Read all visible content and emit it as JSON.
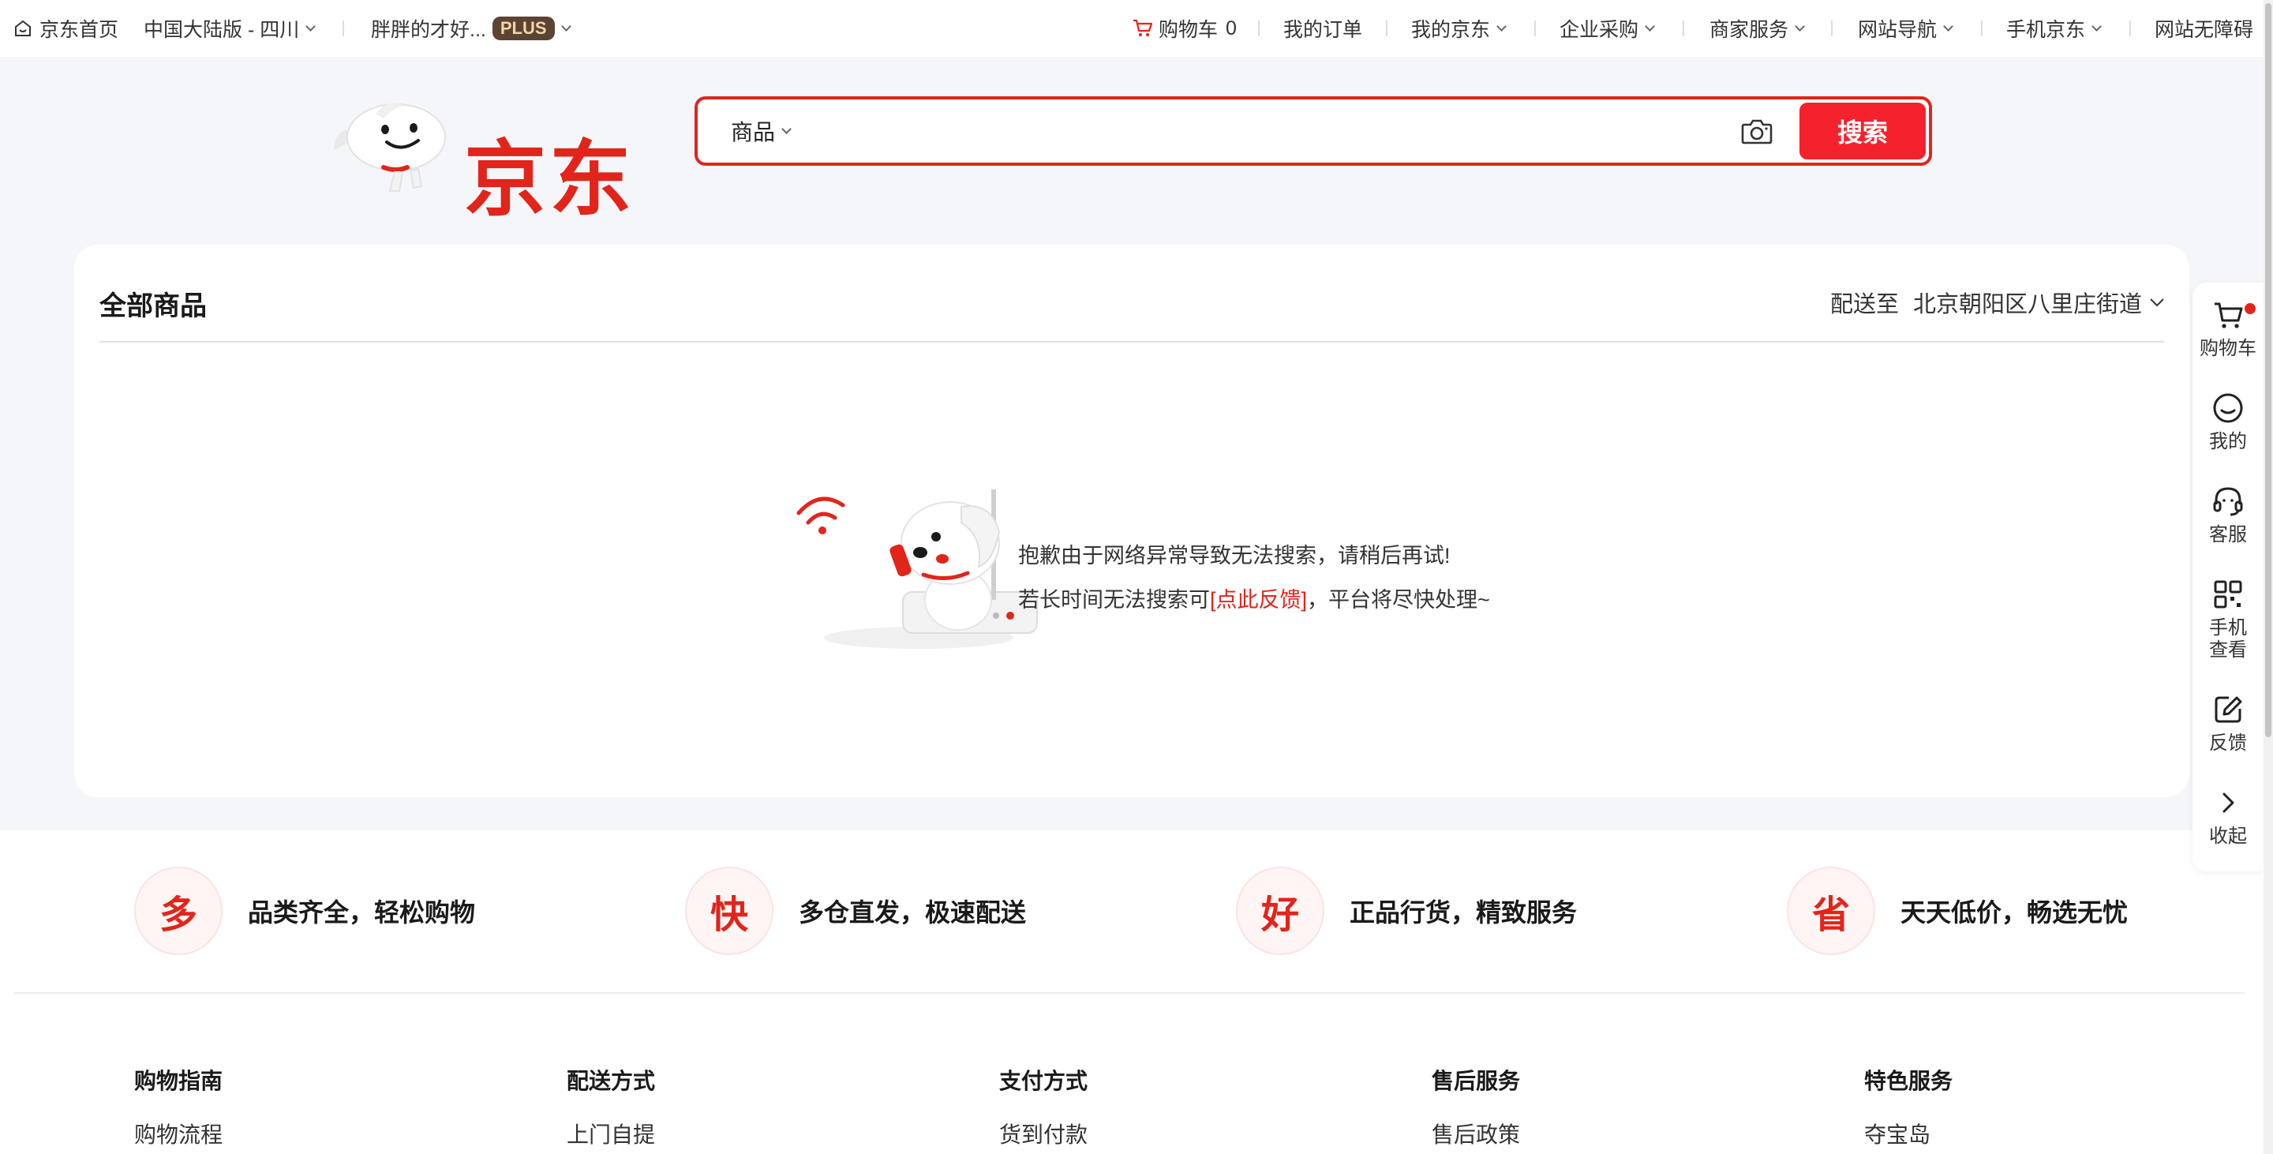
{
  "topbar": {
    "home": "京东首页",
    "region": "中国大陆版 - 四川",
    "user": "胖胖的才好...",
    "plus_badge": "PLUS",
    "cart_label": "购物车",
    "cart_count": "0",
    "orders": "我的订单",
    "my_jd": "我的京东",
    "enterprise": "企业采购",
    "merchant": "商家服务",
    "site_nav": "网站导航",
    "mobile_jd": "手机京东",
    "accessibility": "网站无障碍"
  },
  "logo": {
    "text": "京东"
  },
  "search": {
    "category": "商品",
    "value": "",
    "placeholder": "",
    "button": "搜索"
  },
  "main": {
    "title": "全部商品",
    "deliver_label": "配送至",
    "deliver_addr": "北京朝阳区八里庄街道",
    "error_line1": "抱歉由于网络异常导致无法搜索，请稍后再试!",
    "error_line2_pre": "若长时间无法搜索可",
    "error_link": "[点此反馈]",
    "error_line2_post": "，平台将尽快处理~"
  },
  "features": [
    {
      "char": "多",
      "text": "品类齐全，轻松购物"
    },
    {
      "char": "快",
      "text": "多仓直发，极速配送"
    },
    {
      "char": "好",
      "text": "正品行货，精致服务"
    },
    {
      "char": "省",
      "text": "天天低价，畅选无忧"
    }
  ],
  "footer": [
    {
      "title": "购物指南",
      "item": "购物流程"
    },
    {
      "title": "配送方式",
      "item": "上门自提"
    },
    {
      "title": "支付方式",
      "item": "货到付款"
    },
    {
      "title": "售后服务",
      "item": "售后政策"
    },
    {
      "title": "特色服务",
      "item": "夺宝岛"
    }
  ],
  "sidebar": [
    {
      "label": "购物车",
      "icon": "cart-icon"
    },
    {
      "label": "我的",
      "icon": "smile-icon"
    },
    {
      "label": "客服",
      "icon": "headset-icon"
    },
    {
      "label": "手机查看",
      "icon": "qrcode-icon"
    },
    {
      "label": "反馈",
      "icon": "edit-icon"
    },
    {
      "label": "收起",
      "icon": "chevron-right-icon"
    }
  ],
  "colors": {
    "brand": "#e1251b",
    "search_button": "#f5222d",
    "page_bg": "#f5f6fa",
    "plus_badge_bg": "#5c4433"
  }
}
